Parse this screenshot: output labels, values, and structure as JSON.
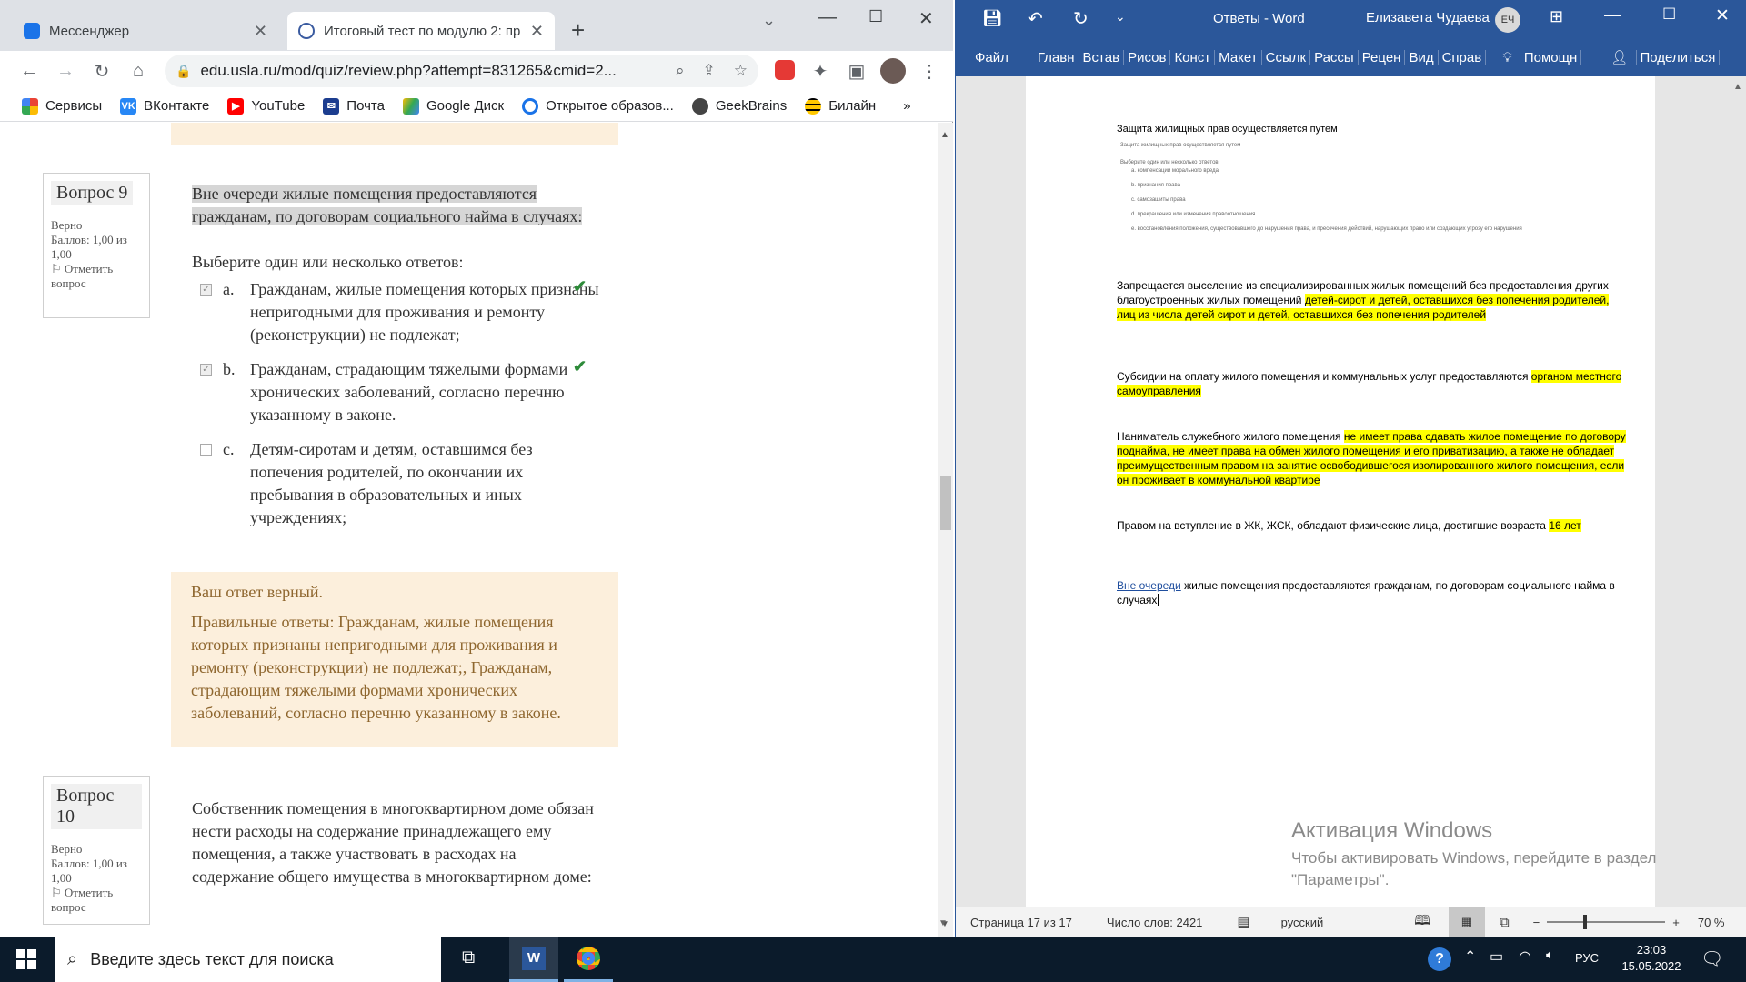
{
  "chrome": {
    "tabs": [
      {
        "label": "Мессенджер",
        "active": false
      },
      {
        "label": "Итоговый тест по модулю 2: пр",
        "active": true
      }
    ],
    "url": "edu.usla.ru/mod/quiz/review.php?attempt=831265&cmid=2...",
    "bookmarks": [
      "Сервисы",
      "ВКонтакте",
      "YouTube",
      "Почта",
      "Google Диск",
      "Открытое образов...",
      "GeekBrains",
      "Билайн"
    ],
    "bookmarks_more": "»"
  },
  "quiz": {
    "q9": {
      "number": "Вопрос 9",
      "state": "Верно",
      "grade": "Баллов: 1,00 из 1,00",
      "flag": "Отметить вопрос",
      "text": "Вне очереди жилые помещения предоставляются гражданам, по договорам социального найма в случаях:",
      "prompt": "Выберите один или несколько ответов:",
      "options": [
        {
          "letter": "a.",
          "text": "Гражданам, жилые помещения которых признаны непригодными для проживания и ремонту (реконструкции) не подлежат;",
          "checked": true,
          "correct": true
        },
        {
          "letter": "b.",
          "text": "Гражданам, страдающим тяжелыми формами хронических заболеваний, согласно перечню указанному в законе.",
          "checked": true,
          "correct": true
        },
        {
          "letter": "c.",
          "text": "Детям-сиротам и детям, оставшимся без попечения родителей, по окончании их пребывания в образовательных и иных учреждениях;",
          "checked": false,
          "correct": false
        }
      ],
      "feedback_title": "Ваш ответ верный.",
      "feedback_right": "Правильные ответы: Гражданам, жилые помещения которых признаны непригодными для проживания и ремонту (реконструкции) не подлежат;, Гражданам, страдающим тяжелыми формами хронических заболеваний, согласно перечню указанному в законе."
    },
    "q10": {
      "number": "Вопрос 10",
      "state": "Верно",
      "grade": "Баллов: 1,00 из 1,00",
      "flag": "Отметить вопрос",
      "text": "Собственник помещения в многоквартирном доме обязан нести расходы на содержание принадлежащего ему помещения, а также участвовать в расходах на содержание общего имущества в многоквартирном доме:"
    }
  },
  "word": {
    "title": "Ответы - Word",
    "user": "Елизавета Чудаева",
    "user_initials": "ЕЧ",
    "ribbon": [
      "Файл",
      "Главн",
      "Встав",
      "Рисов",
      "Конст",
      "Макет",
      "Ссылк",
      "Рассы",
      "Рецен",
      "Вид",
      "Справ",
      "Помощн",
      "Поделиться"
    ],
    "doc": {
      "p1": "Защита жилищных прав осуществляется путем",
      "p1_small": "Защита жилищных прав осуществляется путем",
      "p1_prompt": "Выберите один или несколько ответов:",
      "p1_opts": [
        "a.   компенсации морального вреда",
        "b.   признания права",
        "c.   самозащиты права",
        "d.   прекращения или изменения правоотношения",
        "e.   восстановления положения, существовавшего до нарушения права, и пресечения действий, нарушающих право или создающих угрозу его нарушения"
      ],
      "p2_a": "Запрещается выселение из специализированных жилых помещений без предоставления других благоустроенных жилых помещений ",
      "p2_hl": "детей-сирот и детей, оставшихся без попечения родителей, лиц из числа детей сирот и детей, оставшихся без попечения родителей",
      "p3_a": "Субсидии на оплату жилого помещения и коммунальных услуг предоставляются ",
      "p3_hl": "органом местного самоуправления",
      "p4_a": "Наниматель служебного жилого помещения ",
      "p4_hl": "не имеет права сдавать жилое помещение по договору поднайма,  не имеет права на обмен жилого помещения и его приватизацию, а также не обладает преимущественным правом на занятие освободившегося изолированного жилого помещения, если он проживает в коммунальной квартире",
      "p5_a": "Правом на вступление в ЖК, ЖСК, обладают физические лица, достигшие возраста ",
      "p5_hl": "16 лет",
      "p6_link": "Вне очереди",
      "p6_b": " жилые помещения предоставляются гражданам, по договорам социального найма в случаях"
    },
    "status": {
      "page": "Страница 17 из 17",
      "words": "Число слов: 2421",
      "lang": "русский",
      "zoom": "70 %"
    },
    "activation_title": "Активация Windows",
    "activation_text": "Чтобы активировать Windows, перейдите в раздел \"Параметры\"."
  },
  "taskbar": {
    "search_placeholder": "Введите здесь текст для поиска",
    "lang": "РУС",
    "time": "23:03",
    "date": "15.05.2022"
  }
}
